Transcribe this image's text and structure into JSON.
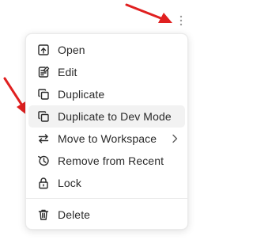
{
  "overflow_button": {
    "icon": "more-vertical-icon"
  },
  "annotation_color": "#e02020",
  "menu": {
    "items": [
      {
        "label": "Open",
        "icon": "open-icon"
      },
      {
        "label": "Edit",
        "icon": "edit-icon"
      },
      {
        "label": "Duplicate",
        "icon": "duplicate-icon"
      },
      {
        "label": "Duplicate to Dev Mode",
        "icon": "duplicate-icon",
        "highlighted": true
      },
      {
        "label": "Move to Workspace",
        "icon": "move-icon",
        "has_submenu": true
      },
      {
        "label": "Remove from Recent",
        "icon": "history-icon"
      },
      {
        "label": "Lock",
        "icon": "lock-icon"
      }
    ],
    "footer_items": [
      {
        "label": "Delete",
        "icon": "trash-icon"
      }
    ]
  }
}
